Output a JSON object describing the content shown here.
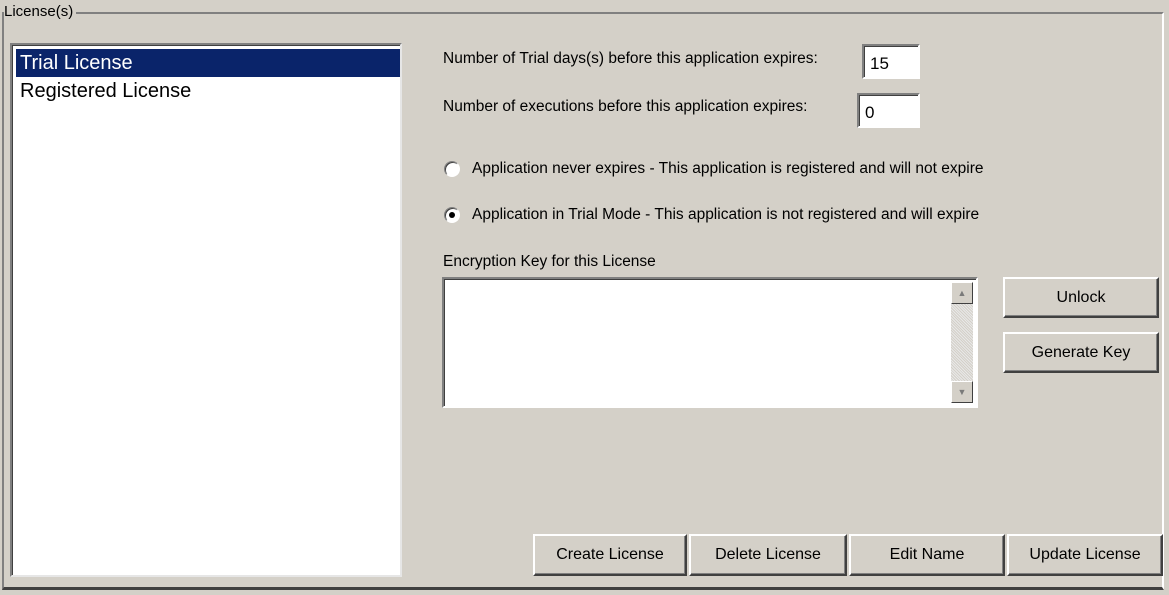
{
  "group": {
    "title": "License(s)"
  },
  "licenses": {
    "items": [
      {
        "label": "Trial License",
        "selected": true
      },
      {
        "label": "Registered License",
        "selected": false
      }
    ]
  },
  "trial_days": {
    "label": "Number of Trial days(s)  before this application expires:",
    "value": "15"
  },
  "executions": {
    "label": "Number of executions before this application expires:",
    "value": "0"
  },
  "mode": {
    "never_expires_label": "Application never expires - This application is registered and will not expire",
    "trial_mode_label": "Application in Trial Mode - This application is not registered and will expire",
    "selected": "trial"
  },
  "encryption": {
    "label": "Encryption Key for this License",
    "value": ""
  },
  "buttons": {
    "unlock": "Unlock",
    "generate_key": "Generate Key",
    "create_license": "Create License",
    "delete_license": "Delete License",
    "edit_name": "Edit Name",
    "update_license": "Update License"
  },
  "icons": {
    "scroll_up": "scroll-up-arrow-icon",
    "scroll_down": "scroll-down-arrow-icon"
  }
}
